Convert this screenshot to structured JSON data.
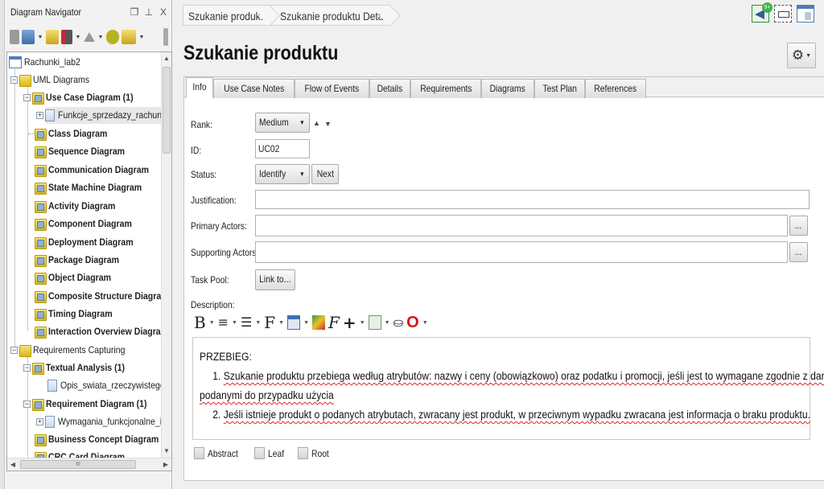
{
  "navigator": {
    "title": "Diagram Navigator",
    "window_buttons": [
      "restore-icon",
      "pin-icon",
      "close-icon"
    ],
    "window_button_glyphs": [
      "❐",
      "⊥",
      "X"
    ],
    "toolbar_icons": [
      "new-icon",
      "diagram-layout-icon",
      "folder-icon",
      "sort-az-icon",
      "up-icon",
      "refresh-icon",
      "open-folder-icon"
    ],
    "tree": {
      "root": "Rachunki_lab2",
      "uml": "UML Diagrams",
      "use_case": "Use Case Diagram (1)",
      "use_case_child": "Funkcje_sprzedazy_rachunkow",
      "class": "Class Diagram",
      "sequence": "Sequence Diagram",
      "communication": "Communication Diagram",
      "state_machine": "State Machine Diagram",
      "activity": "Activity Diagram",
      "component": "Component Diagram",
      "deployment": "Deployment Diagram",
      "package": "Package Diagram",
      "object": "Object Diagram",
      "composite": "Composite Structure Diagram",
      "timing": "Timing Diagram",
      "interaction": "Interaction Overview Diagram",
      "req_capturing": "Requirements Capturing",
      "textual": "Textual Analysis (1)",
      "textual_child": "Opis_swiata_rzeczywistego",
      "req_diagram": "Requirement Diagram (1)",
      "req_child": "Wymagania_funkcjonalne_i_nief",
      "business": "Business Concept Diagram",
      "crc": "CRC Card Diagram"
    },
    "hscroll_grip": "III"
  },
  "breadcrumb": [
    "Szukanie produktu",
    "Szukanie produktu Details"
  ],
  "top_icons": {
    "notification_badge": "9+"
  },
  "page_title": "Szukanie produktu",
  "tabs": [
    "Info",
    "Use Case Notes",
    "Flow of Events",
    "Details",
    "Requirements",
    "Diagrams",
    "Test Plan",
    "References"
  ],
  "active_tab": "Info",
  "form": {
    "rank_label": "Rank:",
    "rank_value": "Medium",
    "id_label": "ID:",
    "id_value": "UC02",
    "status_label": "Status:",
    "status_value": "Identify",
    "next_button": "Next",
    "justification_label": "Justification:",
    "justification_value": "",
    "primary_actors_label": "Primary Actors:",
    "primary_actors_value": "",
    "supporting_actors_label": "Supporting Actors:",
    "supporting_actors_value": "",
    "browse_button": "...",
    "task_pool_label": "Task Pool:",
    "link_button": "Link to...",
    "description_label": "Description:"
  },
  "editor_toolbar": [
    "bold-icon",
    "align-icon",
    "list-icon",
    "font-icon",
    "table-icon",
    "color-icon",
    "format-icon",
    "insert-icon",
    "template-icon",
    "find-icon",
    "spellcheck-icon"
  ],
  "description": {
    "heading": "PRZEBIEG:",
    "line1_prefix": "1. ",
    "line1": "Szukanie produktu przebiega według atrybutów: nazwy i ceny (obowiązkowo) oraz podatku i promocji, jeśli jest to wymagane zgodnie z danymi",
    "line1_cont": "podanymi do przypadku użycia",
    "line2_prefix": "2. ",
    "line2": "Jeśli istnieje produkt o podanych atrybutach, zwracany jest produkt, w przeciwnym wypadku zwracana jest informacja o braku produktu."
  },
  "checkboxes": [
    {
      "label": "Abstract",
      "checked": false
    },
    {
      "label": "Leaf",
      "checked": false
    },
    {
      "label": "Root",
      "checked": false
    }
  ],
  "colors": {
    "accent": "#4f7db5",
    "folder": "#e6c630",
    "spell_error": "#dd2222"
  }
}
